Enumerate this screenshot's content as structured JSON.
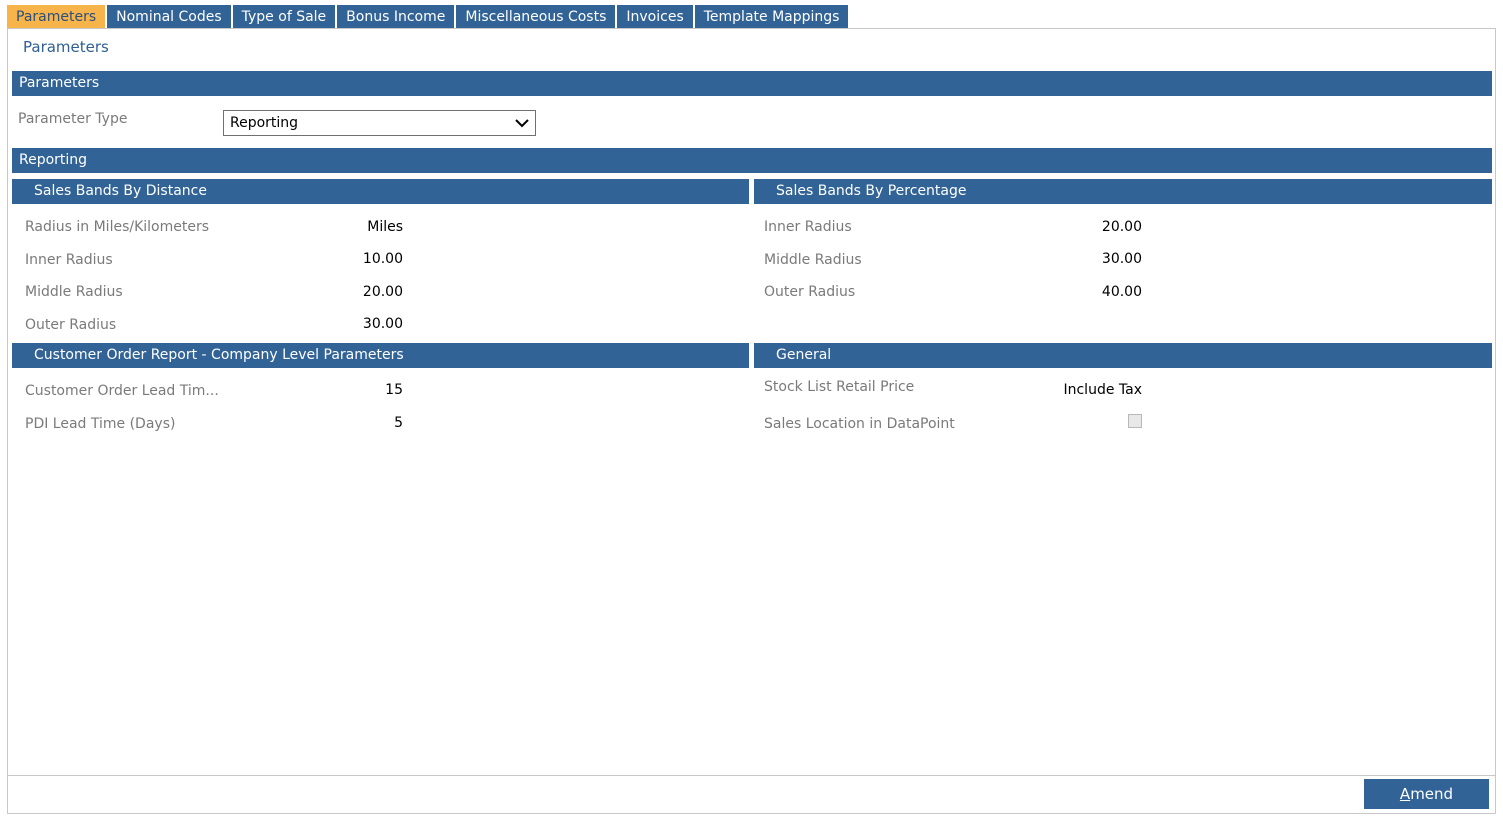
{
  "tabs": [
    {
      "label": "Parameters",
      "active": true
    },
    {
      "label": "Nominal Codes"
    },
    {
      "label": "Type of Sale"
    },
    {
      "label": "Bonus Income"
    },
    {
      "label": "Miscellaneous Costs"
    },
    {
      "label": "Invoices"
    },
    {
      "label": "Template Mappings"
    }
  ],
  "page_title": "Parameters",
  "parameters_section": {
    "header": "Parameters",
    "param_type_label": "Parameter Type",
    "param_type_value": "Reporting"
  },
  "reporting_header": "Reporting",
  "distance": {
    "header": "Sales Bands By Distance",
    "rows": [
      {
        "label": "Radius in Miles/Kilometers",
        "value": "Miles"
      },
      {
        "label": "Inner Radius",
        "value": "10.00"
      },
      {
        "label": "Middle Radius",
        "value": "20.00"
      },
      {
        "label": "Outer Radius",
        "value": "30.00"
      }
    ]
  },
  "percentage": {
    "header": "Sales Bands By Percentage",
    "rows": [
      {
        "label": "Inner Radius",
        "value": "20.00"
      },
      {
        "label": "Middle Radius",
        "value": "30.00"
      },
      {
        "label": "Outer Radius",
        "value": "40.00"
      }
    ]
  },
  "customer_order": {
    "header": "Customer Order Report - Company Level Parameters",
    "rows": [
      {
        "label": "Customer Order Lead Tim...",
        "value": "15"
      },
      {
        "label": "PDI Lead Time (Days)",
        "value": "5"
      }
    ]
  },
  "general": {
    "header": "General",
    "stock_list_label": "Stock List Retail Price",
    "stock_list_value": "Include Tax",
    "sales_location_label": "Sales Location in DataPoint",
    "sales_location_checked": false
  },
  "amend_button": {
    "label_underlined": "A",
    "label_rest": "mend"
  },
  "colors": {
    "header_blue": "#326396",
    "active_tab": "#f6b44a",
    "title_blue": "#2f5f93"
  }
}
